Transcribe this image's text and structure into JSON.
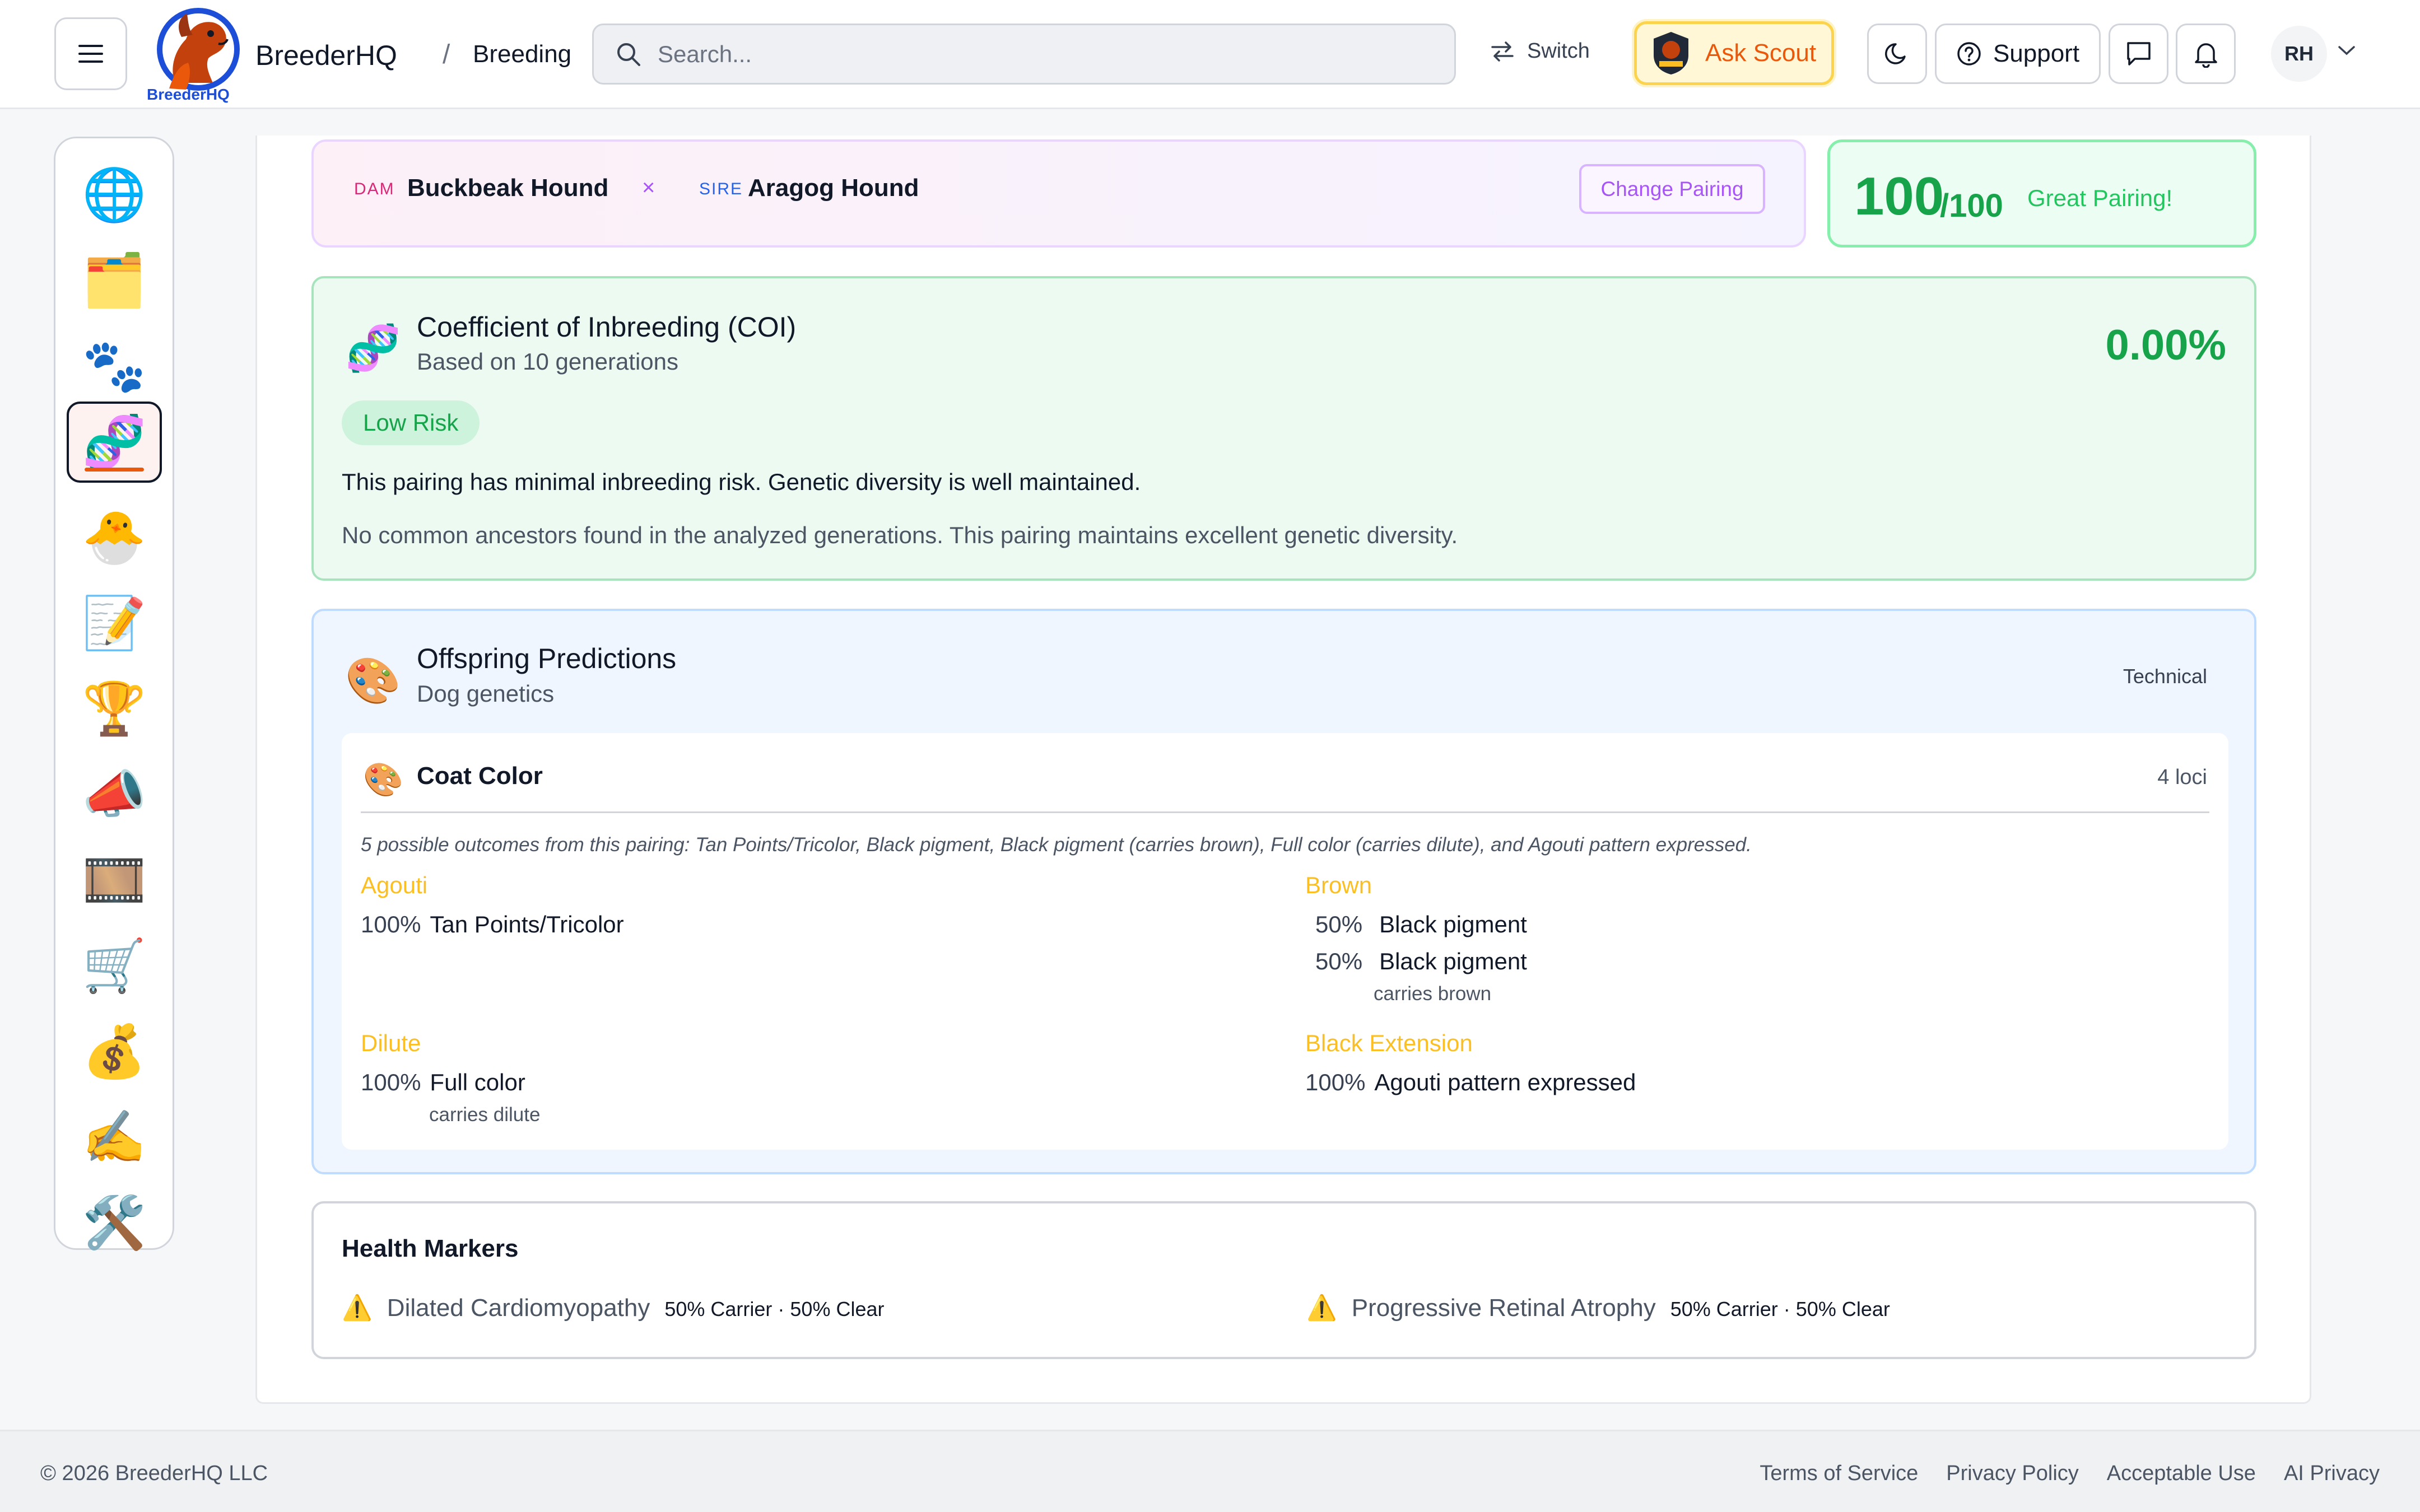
{
  "header": {
    "brand": "BreederHQ",
    "logo_caption": "BreederHQ",
    "breadcrumb_sep": "/",
    "breadcrumb": "Breeding",
    "search_placeholder": "Search...",
    "switch_label": "Switch",
    "ask_scout_label": "Ask Scout",
    "support_label": "Support",
    "avatar_initials": "RH"
  },
  "sidebar": {
    "items": [
      {
        "icon": "globe-icon",
        "glyph": "🌐"
      },
      {
        "icon": "dashboard-icon",
        "glyph": "🗂️"
      },
      {
        "icon": "paw-icon",
        "glyph": "🐾"
      },
      {
        "icon": "dna-icon",
        "glyph": "🧬",
        "active": true
      },
      {
        "icon": "hatching-chick-icon",
        "glyph": "🐣"
      },
      {
        "icon": "memo-icon",
        "glyph": "📝"
      },
      {
        "icon": "trophy-icon",
        "glyph": "🏆"
      },
      {
        "icon": "megaphone-icon",
        "glyph": "📣"
      },
      {
        "icon": "film-icon",
        "glyph": "🎞️"
      },
      {
        "icon": "cart-icon",
        "glyph": "🛒"
      },
      {
        "icon": "money-bag-icon",
        "glyph": "💰"
      },
      {
        "icon": "writing-hand-icon",
        "glyph": "✍️"
      },
      {
        "icon": "tools-icon",
        "glyph": "🛠️"
      }
    ]
  },
  "pairing": {
    "dam_label": "DAM",
    "dam_name": "Buckbeak Hound",
    "times": "×",
    "sire_label": "SIRE",
    "sire_name": "Aragog Hound",
    "change_label": "Change Pairing"
  },
  "score": {
    "value": "100",
    "denominator": "/100",
    "verdict": "Great Pairing!"
  },
  "coi": {
    "title": "Coefficient of Inbreeding (COI)",
    "subtitle": "Based on 10 generations",
    "value": "0.00%",
    "risk": "Low Risk",
    "message": "This pairing has minimal inbreeding risk. Genetic diversity is well maintained.",
    "note": "No common ancestors found in the analyzed generations. This pairing maintains excellent genetic diversity."
  },
  "offspring": {
    "title": "Offspring Predictions",
    "subtitle": "Dog genetics",
    "view_mode": "Technical",
    "coat": {
      "title": "Coat Color",
      "loci": "4 loci",
      "summary": "5 possible outcomes from this pairing: Tan Points/Tricolor, Black pigment, Black pigment (carries brown), Full color (carries dilute), and Agouti pattern expressed.",
      "agouti": {
        "name": "Agouti",
        "rows": [
          {
            "pct": "100%",
            "value": "Tan Points/Tricolor"
          }
        ]
      },
      "brown": {
        "name": "Brown",
        "rows": [
          {
            "pct": "50%",
            "value": "Black pigment"
          },
          {
            "pct": "50%",
            "value": "Black pigment",
            "note": "carries brown"
          }
        ]
      },
      "dilute": {
        "name": "Dilute",
        "rows": [
          {
            "pct": "100%",
            "value": "Full color",
            "note": "carries dilute"
          }
        ]
      },
      "black_extension": {
        "name": "Black Extension",
        "rows": [
          {
            "pct": "100%",
            "value": "Agouti pattern expressed"
          }
        ]
      }
    }
  },
  "health": {
    "title": "Health Markers",
    "markers": [
      {
        "name": "Dilated Cardiomyopathy",
        "status": "50% Carrier · 50% Clear"
      },
      {
        "name": "Progressive Retinal Atrophy",
        "status": "50% Carrier · 50% Clear"
      }
    ]
  },
  "footer": {
    "copyright": "© 2026 BreederHQ LLC",
    "links": [
      "Terms of Service",
      "Privacy Policy",
      "Acceptable Use",
      "AI Privacy"
    ]
  },
  "colors": {
    "accent_orange": "#ea580c",
    "success_green": "#16a34a",
    "locus_gold": "#fbbf24",
    "purple": "#a855f7"
  }
}
